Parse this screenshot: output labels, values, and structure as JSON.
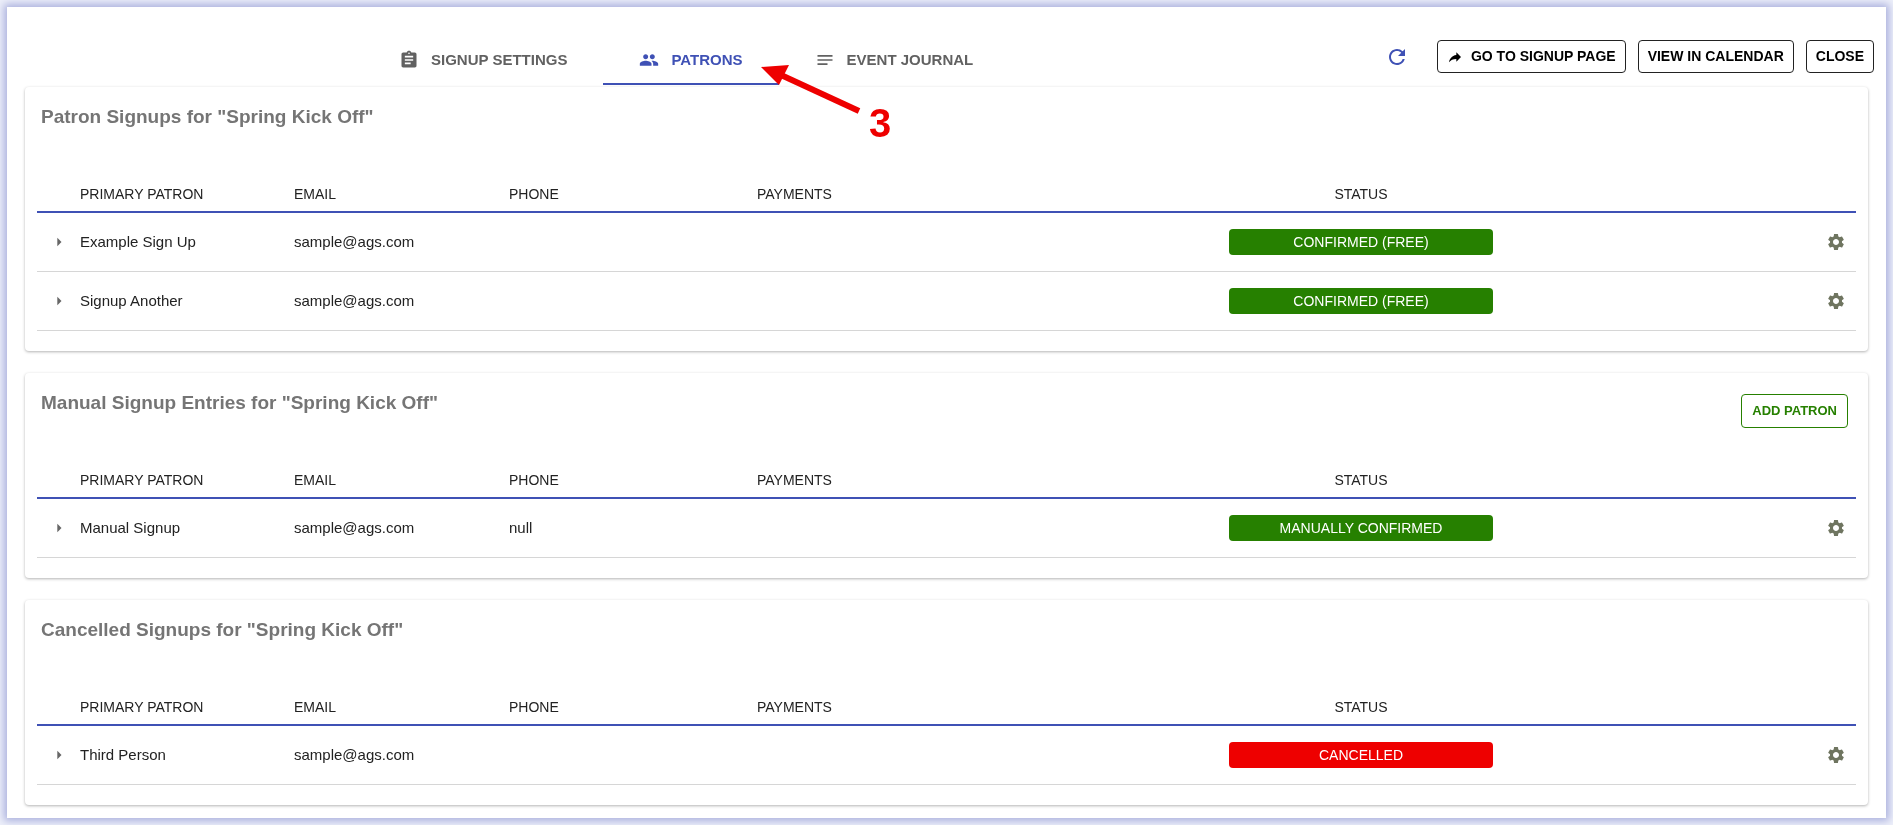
{
  "tabs": [
    {
      "label": "SIGNUP SETTINGS",
      "kind": "clipboard",
      "selected": false
    },
    {
      "label": "PATRONS",
      "kind": "people",
      "selected": true
    },
    {
      "label": "EVENT JOURNAL",
      "kind": "lines",
      "selected": false
    }
  ],
  "toolbar": {
    "buttons": [
      {
        "label": "GO TO SIGNUP PAGE"
      },
      {
        "label": "VIEW IN CALENDAR"
      },
      {
        "label": "CLOSE"
      }
    ]
  },
  "annotation": {
    "label": "3"
  },
  "sections": [
    {
      "title": "Patron Signups for \"Spring Kick Off\"",
      "columns": [
        "PRIMARY PATRON",
        "EMAIL",
        "PHONE",
        "PAYMENTS",
        "STATUS"
      ],
      "rows": [
        {
          "patron": "Example Sign Up",
          "email": "sample@ags.com",
          "status": "CONFIRMED (FREE)",
          "color": "#268000"
        },
        {
          "patron": "Signup Another",
          "email": "sample@ags.com",
          "status": "CONFIRMED (FREE)",
          "color": "#268000"
        }
      ]
    },
    {
      "title": "Manual Signup Entries for \"Spring Kick Off\"",
      "action": "ADD PATRON",
      "columns": [
        "PRIMARY PATRON",
        "EMAIL",
        "PHONE",
        "PAYMENTS",
        "STATUS"
      ],
      "rows": [
        {
          "patron": "Manual Signup",
          "email": "sample@ags.com",
          "phone": "null",
          "status": "MANUALLY CONFIRMED",
          "color": "#268000"
        }
      ]
    },
    {
      "title": "Cancelled Signups for \"Spring Kick Off\"",
      "columns": [
        "PRIMARY PATRON",
        "EMAIL",
        "PHONE",
        "PAYMENTS",
        "STATUS"
      ],
      "rows": [
        {
          "patron": "Third Person",
          "email": "sample@ags.com",
          "status": "CANCELLED",
          "color": "#ee0000"
        }
      ]
    }
  ]
}
